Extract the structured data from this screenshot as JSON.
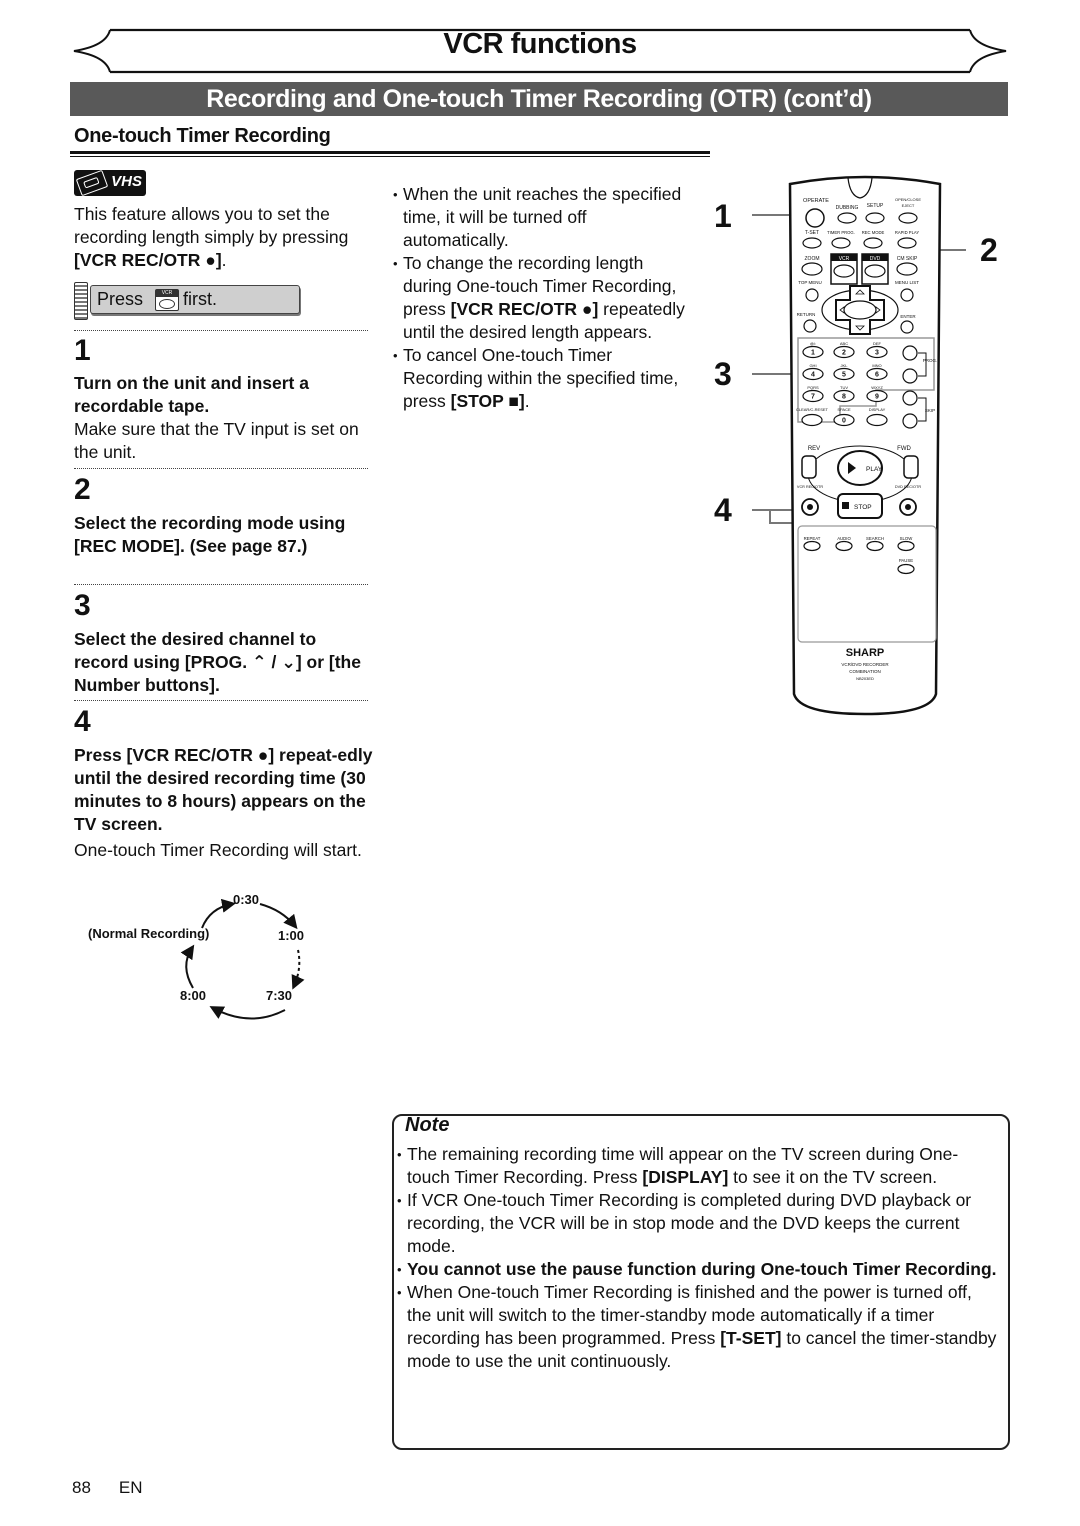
{
  "header": {
    "title": "VCR functions",
    "banner": "Recording and One-touch Timer Recording (OTR) (cont’d)",
    "subhead": "One-touch Timer Recording"
  },
  "badge": {
    "label": "VHS",
    "icon": "vhs-cassette-icon"
  },
  "intro": {
    "text_plain": "This feature allows you to set the recording length simply by pressing ",
    "text_bold": "[VCR REC/OTR ●]",
    "text_end": "."
  },
  "press_first": {
    "pre": "Press",
    "key": "VCR",
    "post": "first."
  },
  "steps": [
    {
      "num": "1",
      "heading": "Turn on the unit and insert a recordable tape.",
      "body": "Make sure that the TV input is set on the unit."
    },
    {
      "num": "2",
      "heading": "Select the recording mode using [REC MODE]. (See page 87.)",
      "body": ""
    },
    {
      "num": "3",
      "heading": "Select the desired channel to record using [PROG. ⌃ / ⌄] or [the Number buttons].",
      "body": ""
    },
    {
      "num": "4",
      "heading": "Press [VCR REC/OTR ●] repeat-edly until the desired recording time (30 minutes to 8 hours) appears on the TV screen.",
      "body": "One-touch Timer Recording will start."
    }
  ],
  "cycle": {
    "labels": [
      "0:30",
      "1:00",
      "7:30",
      "8:00",
      "(Normal Recording)"
    ]
  },
  "middle_bullets": [
    {
      "plain": "When the unit reaches the specified time, it will be turned off automatically."
    },
    {
      "plain": "To change the recording length during One-touch Timer Recording, press ",
      "bold": "[VCR REC/OTR ●]",
      "after": " repeatedly until the desired length appears."
    },
    {
      "plain": "To cancel One-touch Timer Recording within the specified time, press ",
      "bold": "[STOP ■]",
      "after": "."
    }
  ],
  "remote": {
    "callouts": [
      "1",
      "2",
      "3",
      "4"
    ],
    "labels": {
      "operate": "OPERATE",
      "dubbing": "DUBBING",
      "setup": "SETUP",
      "open_close": "OPEN/CLOSE",
      "eject": "EJECT",
      "tset": "T-SET",
      "timer_prog": "TIMER PROG.",
      "rec_mode": "REC MODE",
      "rapid_play": "RAPID PLAY",
      "zoom": "ZOOM",
      "vcr": "VCR",
      "dvd": "DVD",
      "cm_skip": "CM SKIP",
      "top_menu": "TOP MENU",
      "menu_list": "MENU LIST",
      "return": "RETURN",
      "enter": "ENTER",
      "prog": "PROG.",
      "skip": "SKIP",
      "clear": "CLEAR/C-RESET",
      "space": "SPACE",
      "display": "DISPLAY",
      "rev": "REV",
      "fwd": "FWD",
      "play": "PLAY",
      "stop": "STOP",
      "vcr_rec": "VCR REC/OTR",
      "dvd_rec": "DVD REC/OTR",
      "repeat": "REPEAT",
      "audio": "AUDIO",
      "search": "SEARCH",
      "slow": "SLOW",
      "pause": "PAUSE",
      "brand": "SHARP",
      "model_line1": "VCR/DVD RECORDER",
      "model_line2": "COMBINATION",
      "model_code": "NB203ED"
    },
    "number_keys": [
      {
        "digit": "1",
        "letters": "@/:"
      },
      {
        "digit": "2",
        "letters": "ABC"
      },
      {
        "digit": "3",
        "letters": "DEF"
      },
      {
        "digit": "4",
        "letters": "GHI"
      },
      {
        "digit": "5",
        "letters": "JKL"
      },
      {
        "digit": "6",
        "letters": "MNO"
      },
      {
        "digit": "7",
        "letters": "PQRS"
      },
      {
        "digit": "8",
        "letters": "TUV"
      },
      {
        "digit": "9",
        "letters": "WXYZ"
      },
      {
        "digit": "0",
        "letters": "SPACE"
      }
    ]
  },
  "note": {
    "title": "Note",
    "items": [
      {
        "plain": "The remaining recording time will appear on the TV screen during One-touch Timer Recording. Press ",
        "bold": "[DISPLAY]",
        "after": " to see it on the TV screen."
      },
      {
        "plain": "If VCR One-touch Timer Recording is completed during DVD playback or recording, the VCR will be in stop mode and the DVD keeps the current mode."
      },
      {
        "bold_all": "You cannot use the pause function during One-touch Timer Recording."
      },
      {
        "plain": "When One-touch Timer Recording is finished and the power is turned off, the unit will switch to the timer-standby mode automatically if a timer recording has been programmed. Press ",
        "bold": "[T-SET]",
        "after": " to cancel the timer-standby mode to use the unit continuously."
      }
    ]
  },
  "footer": {
    "page": "88",
    "lang": "EN"
  }
}
